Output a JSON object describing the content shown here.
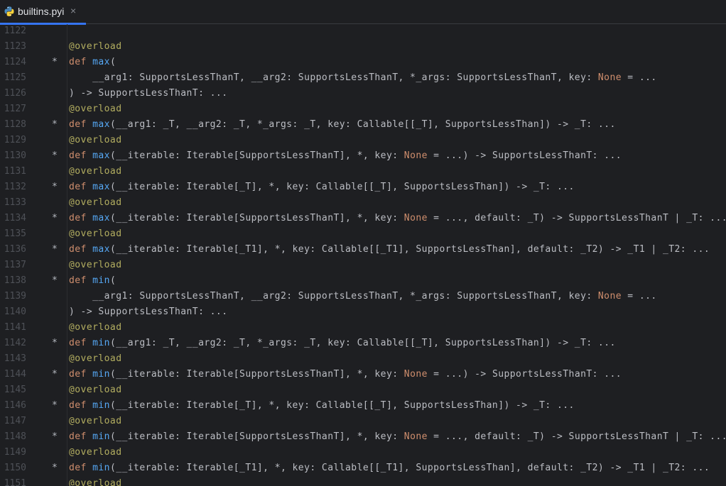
{
  "tab": {
    "filename": "builtins.pyi",
    "close_glyph": "×",
    "icon": "python-file-icon",
    "underline_color": "#3574f0"
  },
  "colors": {
    "background": "#1e1f22",
    "keyword": "#cf8e6d",
    "decorator": "#b3ae60",
    "function_name": "#56a8f5",
    "text": "#bcbec4",
    "line_number": "#4e5157"
  },
  "editor": {
    "lines": [
      {
        "number": "1122",
        "marker": "",
        "tokens": []
      },
      {
        "number": "1123",
        "marker": "",
        "tokens": [
          {
            "t": "@overload",
            "c": "dec"
          }
        ]
      },
      {
        "number": "1124",
        "marker": "*",
        "tokens": [
          {
            "t": "def ",
            "c": "kw"
          },
          {
            "t": "max",
            "c": "fn"
          },
          {
            "t": "(",
            "c": "txt"
          }
        ]
      },
      {
        "number": "1125",
        "marker": "",
        "tokens": [
          {
            "t": "    __arg1: SupportsLessThanT, __arg2: SupportsLessThanT, *_args: SupportsLessThanT, key: ",
            "c": "txt"
          },
          {
            "t": "None",
            "c": "none"
          },
          {
            "t": " = ...",
            "c": "txt"
          }
        ]
      },
      {
        "number": "1126",
        "marker": "",
        "tokens": [
          {
            "t": ") -> SupportsLessThanT: ...",
            "c": "txt"
          }
        ]
      },
      {
        "number": "1127",
        "marker": "",
        "tokens": [
          {
            "t": "@overload",
            "c": "dec"
          }
        ]
      },
      {
        "number": "1128",
        "marker": "*",
        "tokens": [
          {
            "t": "def ",
            "c": "kw"
          },
          {
            "t": "max",
            "c": "fn"
          },
          {
            "t": "(__arg1: _T, __arg2: _T, *_args: _T, key: Callable[[_T], SupportsLessThan]) -> _T: ...",
            "c": "txt"
          }
        ]
      },
      {
        "number": "1129",
        "marker": "",
        "tokens": [
          {
            "t": "@overload",
            "c": "dec"
          }
        ]
      },
      {
        "number": "1130",
        "marker": "*",
        "tokens": [
          {
            "t": "def ",
            "c": "kw"
          },
          {
            "t": "max",
            "c": "fn"
          },
          {
            "t": "(__iterable: Iterable[SupportsLessThanT], *, key: ",
            "c": "txt"
          },
          {
            "t": "None",
            "c": "none"
          },
          {
            "t": " = ...) -> SupportsLessThanT: ...",
            "c": "txt"
          }
        ]
      },
      {
        "number": "1131",
        "marker": "",
        "tokens": [
          {
            "t": "@overload",
            "c": "dec"
          }
        ]
      },
      {
        "number": "1132",
        "marker": "*",
        "tokens": [
          {
            "t": "def ",
            "c": "kw"
          },
          {
            "t": "max",
            "c": "fn"
          },
          {
            "t": "(__iterable: Iterable[_T], *, key: Callable[[_T], SupportsLessThan]) -> _T: ...",
            "c": "txt"
          }
        ]
      },
      {
        "number": "1133",
        "marker": "",
        "tokens": [
          {
            "t": "@overload",
            "c": "dec"
          }
        ]
      },
      {
        "number": "1134",
        "marker": "*",
        "tokens": [
          {
            "t": "def ",
            "c": "kw"
          },
          {
            "t": "max",
            "c": "fn"
          },
          {
            "t": "(__iterable: Iterable[SupportsLessThanT], *, key: ",
            "c": "txt"
          },
          {
            "t": "None",
            "c": "none"
          },
          {
            "t": " = ..., default: _T) -> SupportsLessThanT | _T: ...",
            "c": "txt"
          }
        ]
      },
      {
        "number": "1135",
        "marker": "",
        "tokens": [
          {
            "t": "@overload",
            "c": "dec"
          }
        ]
      },
      {
        "number": "1136",
        "marker": "*",
        "tokens": [
          {
            "t": "def ",
            "c": "kw"
          },
          {
            "t": "max",
            "c": "fn"
          },
          {
            "t": "(__iterable: Iterable[_T1], *, key: Callable[[_T1], SupportsLessThan], default: _T2) -> _T1 | _T2: ...",
            "c": "txt"
          }
        ]
      },
      {
        "number": "1137",
        "marker": "",
        "tokens": [
          {
            "t": "@overload",
            "c": "dec"
          }
        ]
      },
      {
        "number": "1138",
        "marker": "*",
        "tokens": [
          {
            "t": "def ",
            "c": "kw"
          },
          {
            "t": "min",
            "c": "fn"
          },
          {
            "t": "(",
            "c": "txt"
          }
        ]
      },
      {
        "number": "1139",
        "marker": "",
        "tokens": [
          {
            "t": "    __arg1: SupportsLessThanT, __arg2: SupportsLessThanT, *_args: SupportsLessThanT, key: ",
            "c": "txt"
          },
          {
            "t": "None",
            "c": "none"
          },
          {
            "t": " = ...",
            "c": "txt"
          }
        ]
      },
      {
        "number": "1140",
        "marker": "",
        "tokens": [
          {
            "t": ") -> SupportsLessThanT: ...",
            "c": "txt"
          }
        ]
      },
      {
        "number": "1141",
        "marker": "",
        "tokens": [
          {
            "t": "@overload",
            "c": "dec"
          }
        ]
      },
      {
        "number": "1142",
        "marker": "*",
        "tokens": [
          {
            "t": "def ",
            "c": "kw"
          },
          {
            "t": "min",
            "c": "fn"
          },
          {
            "t": "(__arg1: _T, __arg2: _T, *_args: _T, key: Callable[[_T], SupportsLessThan]) -> _T: ...",
            "c": "txt"
          }
        ]
      },
      {
        "number": "1143",
        "marker": "",
        "tokens": [
          {
            "t": "@overload",
            "c": "dec"
          }
        ]
      },
      {
        "number": "1144",
        "marker": "*",
        "tokens": [
          {
            "t": "def ",
            "c": "kw"
          },
          {
            "t": "min",
            "c": "fn"
          },
          {
            "t": "(__iterable: Iterable[SupportsLessThanT], *, key: ",
            "c": "txt"
          },
          {
            "t": "None",
            "c": "none"
          },
          {
            "t": " = ...) -> SupportsLessThanT: ...",
            "c": "txt"
          }
        ]
      },
      {
        "number": "1145",
        "marker": "",
        "tokens": [
          {
            "t": "@overload",
            "c": "dec"
          }
        ]
      },
      {
        "number": "1146",
        "marker": "*",
        "tokens": [
          {
            "t": "def ",
            "c": "kw"
          },
          {
            "t": "min",
            "c": "fn"
          },
          {
            "t": "(__iterable: Iterable[_T], *, key: Callable[[_T], SupportsLessThan]) -> _T: ...",
            "c": "txt"
          }
        ]
      },
      {
        "number": "1147",
        "marker": "",
        "tokens": [
          {
            "t": "@overload",
            "c": "dec"
          }
        ]
      },
      {
        "number": "1148",
        "marker": "*",
        "tokens": [
          {
            "t": "def ",
            "c": "kw"
          },
          {
            "t": "min",
            "c": "fn"
          },
          {
            "t": "(__iterable: Iterable[SupportsLessThanT], *, key: ",
            "c": "txt"
          },
          {
            "t": "None",
            "c": "none"
          },
          {
            "t": " = ..., default: _T) -> SupportsLessThanT | _T: ...",
            "c": "txt"
          }
        ]
      },
      {
        "number": "1149",
        "marker": "",
        "tokens": [
          {
            "t": "@overload",
            "c": "dec"
          }
        ]
      },
      {
        "number": "1150",
        "marker": "*",
        "tokens": [
          {
            "t": "def ",
            "c": "kw"
          },
          {
            "t": "min",
            "c": "fn"
          },
          {
            "t": "(__iterable: Iterable[_T1], *, key: Callable[[_T1], SupportsLessThan], default: _T2) -> _T1 | _T2: ...",
            "c": "txt"
          }
        ]
      },
      {
        "number": "1151",
        "marker": "",
        "tokens": [
          {
            "t": "@overload",
            "c": "dec"
          }
        ]
      }
    ]
  }
}
